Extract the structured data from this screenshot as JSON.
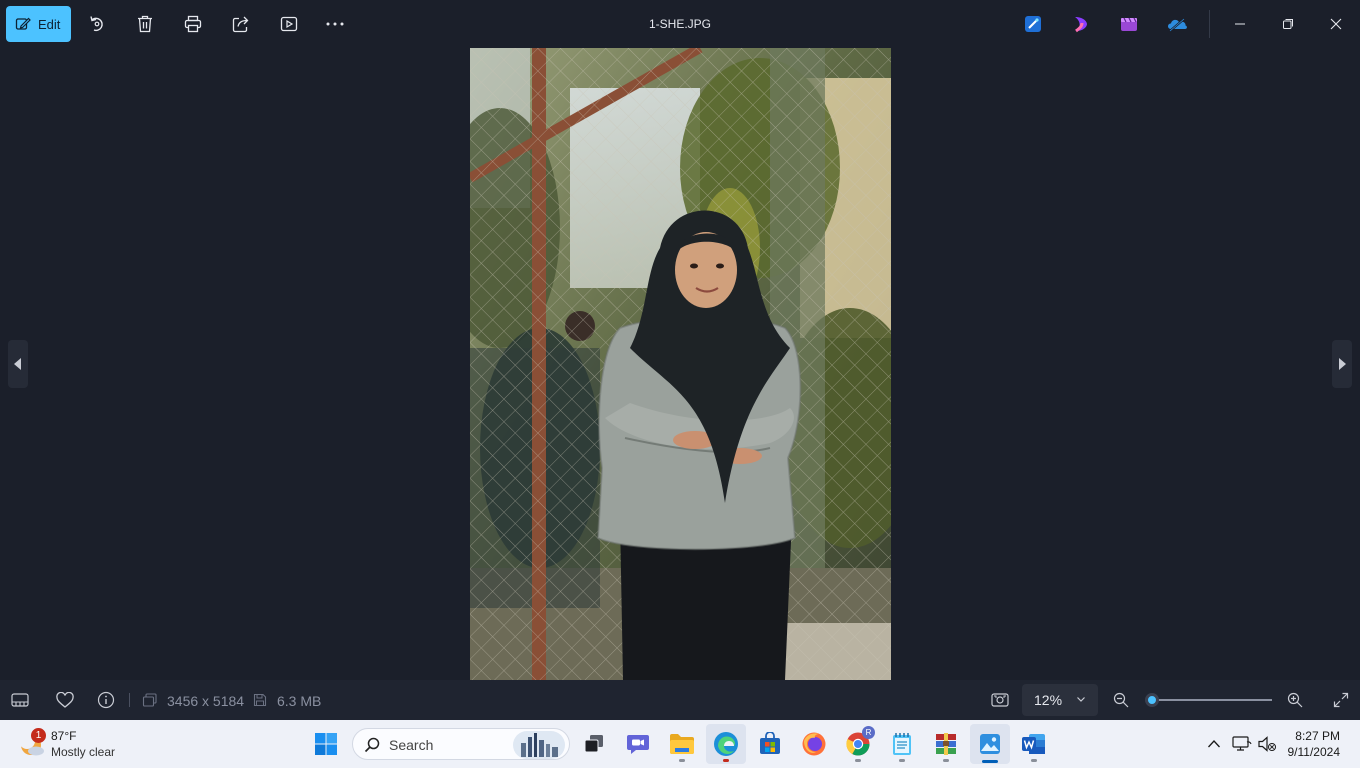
{
  "toolbar": {
    "edit_label": "Edit",
    "icons": [
      "rotate-icon",
      "delete-icon",
      "print-icon",
      "share-icon",
      "slideshow-icon",
      "more-icon"
    ]
  },
  "window": {
    "title": "1-SHE.JPG"
  },
  "shortcuts": [
    "designer-app",
    "clipchamp-app",
    "video-editor-app",
    "onedrive-app"
  ],
  "status": {
    "dimensions": "3456 x 5184",
    "file_size": "6.3 MB",
    "zoom": "12%",
    "zoom_slider_level": 0.0
  },
  "taskbar": {
    "weather": {
      "badge": "1",
      "temperature": "87°F",
      "condition": "Mostly clear"
    },
    "search_placeholder": "Search",
    "apps": [
      "windows-start",
      "task-view",
      "teams-chat",
      "file-explorer",
      "edge",
      "microsoft-store",
      "firefox",
      "chrome",
      "notepad",
      "winrar",
      "photos",
      "word"
    ],
    "chrome_profile_badge": "R",
    "clock": {
      "time": "8:27 PM",
      "date": "9/11/2024"
    }
  },
  "colors": {
    "accent": "#4cc2ff",
    "background": "#1b1f2a",
    "taskbar": "#eef1f8"
  }
}
